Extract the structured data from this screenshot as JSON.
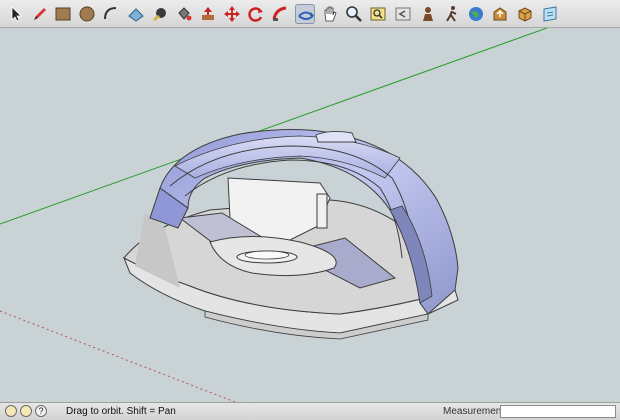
{
  "toolbar": {
    "tools": [
      {
        "name": "select-tool",
        "icon": "arrow-cursor-icon"
      },
      {
        "name": "pencil-tool",
        "icon": "pencil-icon"
      },
      {
        "name": "rectangle-tool",
        "icon": "rectangle-icon"
      },
      {
        "name": "circle-tool",
        "icon": "circle-icon"
      },
      {
        "name": "arc-tool",
        "icon": "arc-icon"
      },
      {
        "name": "eraser-tool",
        "icon": "eraser-icon"
      },
      {
        "name": "tape-measure-tool",
        "icon": "tape-measure-icon"
      },
      {
        "name": "paint-bucket-tool",
        "icon": "paint-bucket-icon"
      },
      {
        "name": "push-pull-tool",
        "icon": "push-pull-icon"
      },
      {
        "name": "move-tool",
        "icon": "move-icon"
      },
      {
        "name": "rotate-tool",
        "icon": "rotate-icon"
      },
      {
        "name": "follow-me-tool",
        "icon": "follow-me-icon"
      },
      {
        "name": "orbit-tool",
        "icon": "orbit-icon",
        "active": true
      },
      {
        "name": "pan-tool",
        "icon": "hand-icon"
      },
      {
        "name": "zoom-tool",
        "icon": "magnifier-icon"
      },
      {
        "name": "zoom-extents-tool",
        "icon": "zoom-extents-icon"
      },
      {
        "name": "previous-view-tool",
        "icon": "previous-view-icon"
      },
      {
        "name": "position-camera-tool",
        "icon": "position-camera-icon"
      },
      {
        "name": "walk-tool",
        "icon": "walk-icon"
      },
      {
        "name": "get-models-tool",
        "icon": "globe-icon"
      },
      {
        "name": "share-model-tool",
        "icon": "share-icon"
      },
      {
        "name": "components-tool",
        "icon": "components-icon"
      },
      {
        "name": "extension-tool",
        "icon": "extension-icon"
      }
    ]
  },
  "colors": {
    "sky": "#c9d2d5",
    "shell": "#aab2e4",
    "base": "#e9e9e9",
    "axis_green": "#2a9d2a",
    "axis_red": "#c44"
  },
  "statusbar": {
    "icons": [
      "geo-location-icon",
      "credits-icon",
      "help-icon"
    ],
    "help_glyph": "?",
    "hint": "Drag to orbit.  Shift = Pan",
    "measurements_label": "Measurements",
    "measurements_value": ""
  }
}
